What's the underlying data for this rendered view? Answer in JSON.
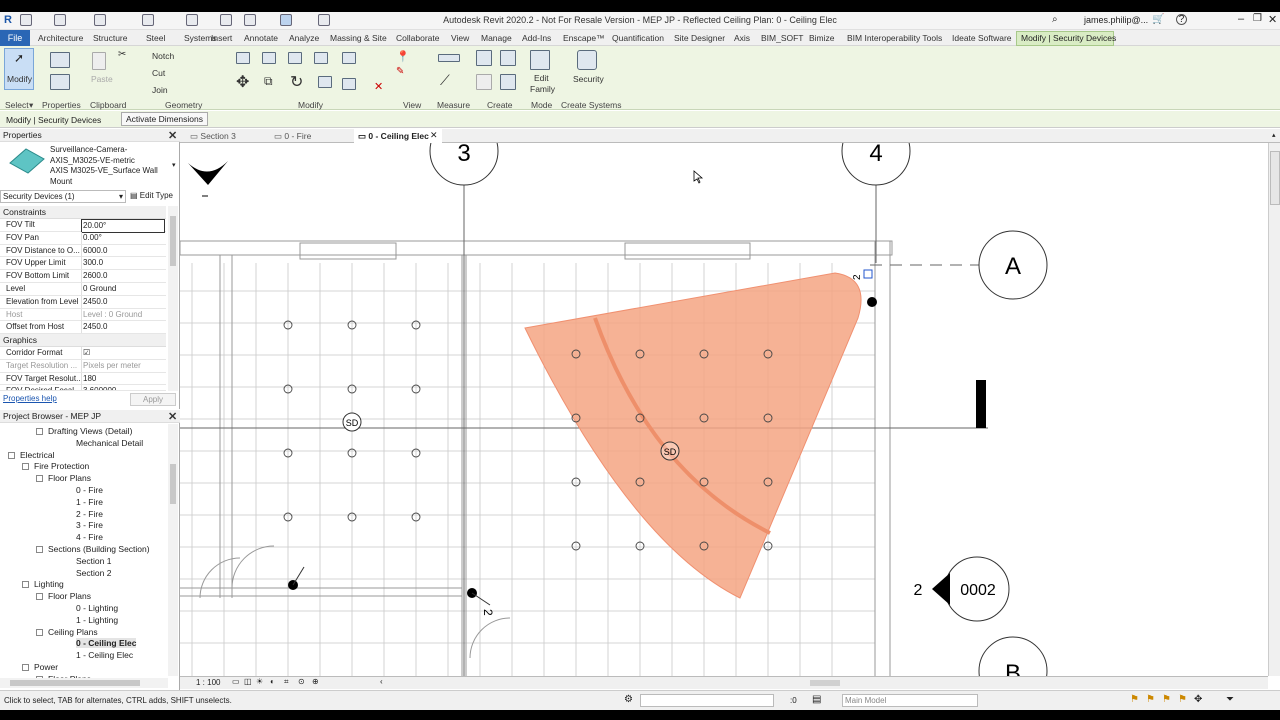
{
  "window": {
    "title": "Autodesk Revit 2020.2 - Not For Resale Version - MEP JP - Reflected Ceiling Plan: 0 - Ceiling Elec",
    "user": "james.philip@...",
    "help": "?"
  },
  "menu": {
    "file": "File",
    "tabs": [
      "Architecture",
      "Structure",
      "Steel",
      "Systems",
      "Insert",
      "Annotate",
      "Analyze",
      "Massing & Site",
      "Collaborate",
      "View",
      "Manage",
      "Add-Ins",
      "Enscape™",
      "Quantification",
      "Site Designer",
      "Axis",
      "BIM_SOFT",
      "Bimize",
      "BIM Interoperability Tools",
      "Ideate Software",
      "Modify | Security Devices"
    ]
  },
  "ribbon": {
    "modify": "Modify",
    "paste": "Paste",
    "notch": "Notch",
    "cut": "Cut",
    "join": "Join",
    "edit_family": "Edit\nFamily",
    "edit_family_1": "Edit",
    "edit_family_2": "Family",
    "security": "Security",
    "panels": {
      "select": "Select",
      "properties": "Properties",
      "clipboard": "Clipboard",
      "geometry": "Geometry",
      "modify": "Modify",
      "view": "View",
      "measure": "Measure",
      "create": "Create",
      "mode": "Mode",
      "create_systems": "Create Systems"
    }
  },
  "optionsbar": {
    "context": "Modify | Security Devices",
    "activate": "Activate Dimensions"
  },
  "view_tabs": [
    "Section 3",
    "0 - Fire",
    "0 - Ceiling Elec"
  ],
  "properties": {
    "header": "Properties",
    "type_line1": "Surveillance-Camera-",
    "type_line2": "AXIS_M3025-VE-metric",
    "type_line3": "AXIS M3025-VE_Surface Wall",
    "type_line4": "Mount",
    "selector": "Security Devices (1)",
    "edit_type": "Edit Type",
    "sec_constraints": "Constraints",
    "sec_graphics": "Graphics",
    "rows": [
      {
        "k": "FOV Tilt",
        "v": "20.00°"
      },
      {
        "k": "FOV Pan",
        "v": "0.00°"
      },
      {
        "k": "FOV Distance to O...",
        "v": "6000.0"
      },
      {
        "k": "FOV Upper Limit",
        "v": "300.0"
      },
      {
        "k": "FOV Bottom Limit",
        "v": "2600.0"
      },
      {
        "k": "Level",
        "v": "0 Ground"
      },
      {
        "k": "Elevation from Level",
        "v": "2450.0"
      },
      {
        "k": "Host",
        "v": "Level : 0 Ground"
      },
      {
        "k": "Offset from Host",
        "v": "2450.0"
      }
    ],
    "grows": [
      {
        "k": "Corridor Format",
        "v": "☑"
      },
      {
        "k": "Target Resolution ...",
        "v": "Pixels per meter"
      },
      {
        "k": "FOV Target Resolut...",
        "v": "180"
      },
      {
        "k": "FOV Desired Focal ...",
        "v": "3.600000"
      }
    ],
    "help": "Properties help",
    "apply": "Apply"
  },
  "browser": {
    "header": "Project Browser - MEP JP",
    "nodes": [
      {
        "t": "Drafting Views (Detail)",
        "l": 3,
        "box": true
      },
      {
        "t": "Mechanical Detail",
        "l": 4
      },
      {
        "t": "Electrical",
        "l": 1,
        "box": true
      },
      {
        "t": "Fire Protection",
        "l": 2,
        "box": true
      },
      {
        "t": "Floor Plans",
        "l": 3,
        "box": true
      },
      {
        "t": "0 - Fire",
        "l": 4
      },
      {
        "t": "1 - Fire",
        "l": 4
      },
      {
        "t": "2 - Fire",
        "l": 4
      },
      {
        "t": "3 - Fire",
        "l": 4
      },
      {
        "t": "4 - Fire",
        "l": 4
      },
      {
        "t": "Sections (Building Section)",
        "l": 3,
        "box": true
      },
      {
        "t": "Section 1",
        "l": 4
      },
      {
        "t": "Section 2",
        "l": 4
      },
      {
        "t": "Lighting",
        "l": 2,
        "box": true
      },
      {
        "t": "Floor Plans",
        "l": 3,
        "box": true
      },
      {
        "t": "0 - Lighting",
        "l": 4
      },
      {
        "t": "1 - Lighting",
        "l": 4
      },
      {
        "t": "Ceiling Plans",
        "l": 3,
        "box": true
      },
      {
        "t": "0 - Ceiling Elec",
        "l": 4,
        "bold": true
      },
      {
        "t": "1 - Ceiling Elec",
        "l": 4
      },
      {
        "t": "Power",
        "l": 2,
        "box": true
      },
      {
        "t": "Floor Plans",
        "l": 3,
        "box": true
      }
    ]
  },
  "canvas": {
    "grid_3": "3",
    "grid_4": "4",
    "grid_A": "A",
    "grid_B": "B",
    "sd": "SD",
    "section_num": "2",
    "section_tag": "0002",
    "tag_2": "2"
  },
  "viewcontrol": {
    "scale": "1 : 100"
  },
  "status": {
    "hint": "Click to select, TAB for alternates, CTRL adds, SHIFT unselects.",
    "workset": ":0",
    "model": "Main Model"
  },
  "colors": {
    "fov_cone": "#f4a582",
    "ribbon_bg": "#eef5e3",
    "file_tab": "#2a66b5"
  }
}
